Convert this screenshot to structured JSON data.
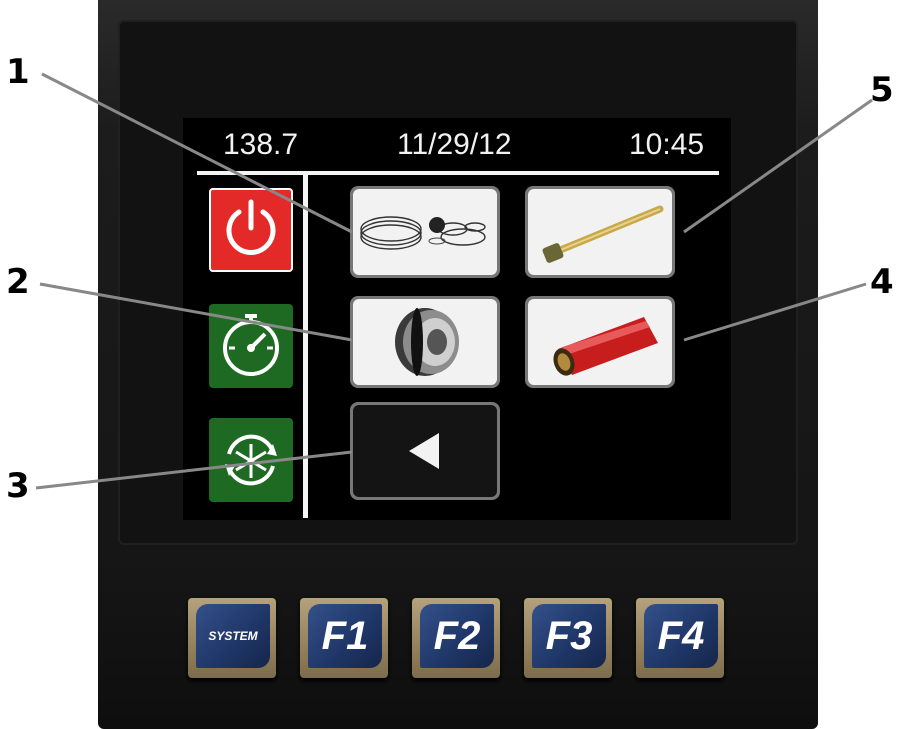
{
  "header": {
    "value": "138.7",
    "date": "11/29/12",
    "time": "10:45"
  },
  "sidebar": {
    "items": [
      {
        "icon": "power-icon",
        "color": "#e32a28"
      },
      {
        "icon": "gauge-icon",
        "color": "#1f6a22"
      },
      {
        "icon": "snowflake-cycle-icon",
        "color": "#1f6a22"
      }
    ]
  },
  "tiles": [
    {
      "icon": "seal-rings-icon"
    },
    {
      "icon": "rod-icon"
    },
    {
      "icon": "piston-icon"
    },
    {
      "icon": "tube-icon"
    },
    {
      "icon": "back-arrow-icon"
    }
  ],
  "fkeys": [
    "SYSTEM",
    "F1",
    "F2",
    "F3",
    "F4"
  ],
  "callouts": [
    "1",
    "2",
    "3",
    "4",
    "5"
  ]
}
